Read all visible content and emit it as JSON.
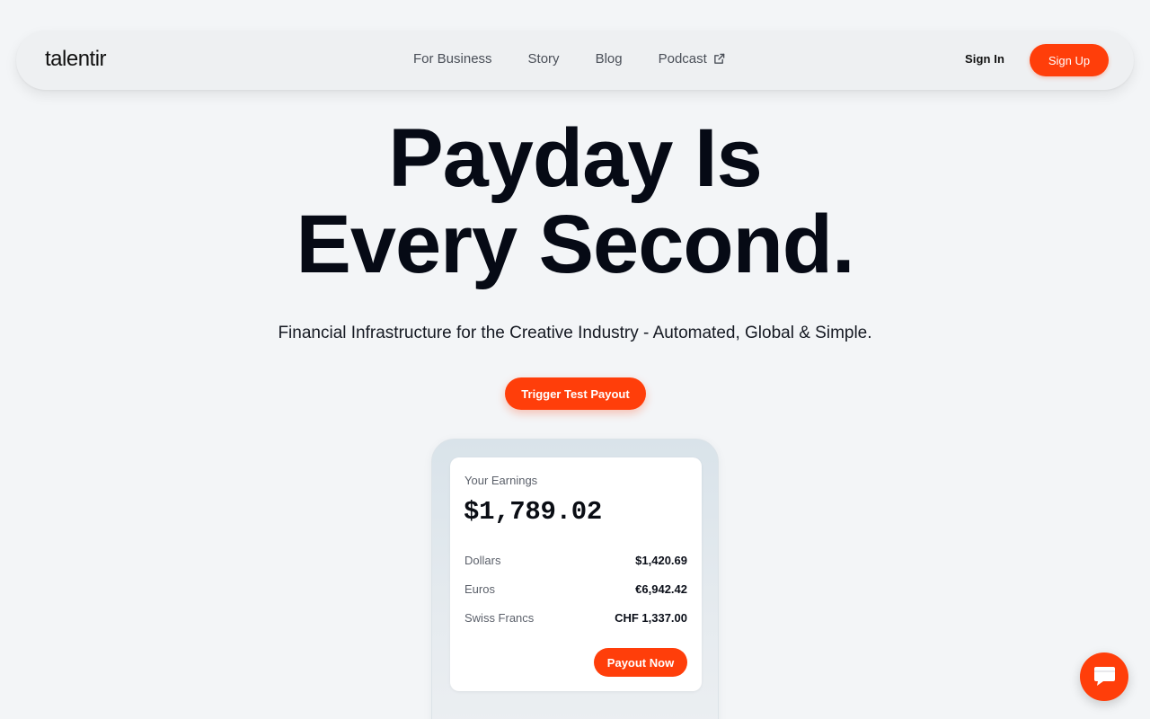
{
  "nav": {
    "logo": "talentir",
    "links": [
      {
        "label": "For Business"
      },
      {
        "label": "Story"
      },
      {
        "label": "Blog"
      },
      {
        "label": "Podcast",
        "icon": "external-link-icon"
      }
    ],
    "sign_in": "Sign In",
    "sign_up": "Sign Up"
  },
  "hero": {
    "title_line1": "Payday Is",
    "title_line2": "Every Second.",
    "subtitle": "Financial Infrastructure for the Creative Industry - Automated, Global & Simple.",
    "cta": "Trigger Test Payout"
  },
  "earnings": {
    "label": "Your Earnings",
    "total": "$1,789.02",
    "rows": [
      {
        "name": "Dollars",
        "value": "$1,420.69"
      },
      {
        "name": "Euros",
        "value": "€6,942.42"
      },
      {
        "name": "Swiss Francs",
        "value": "CHF 1,337.00"
      }
    ],
    "payout_button": "Payout Now"
  },
  "chat": {
    "icon": "chat-bubble-icon"
  },
  "colors": {
    "accent": "#ff3e0a",
    "background": "#f3f5f7",
    "text": "#0b0f19"
  }
}
